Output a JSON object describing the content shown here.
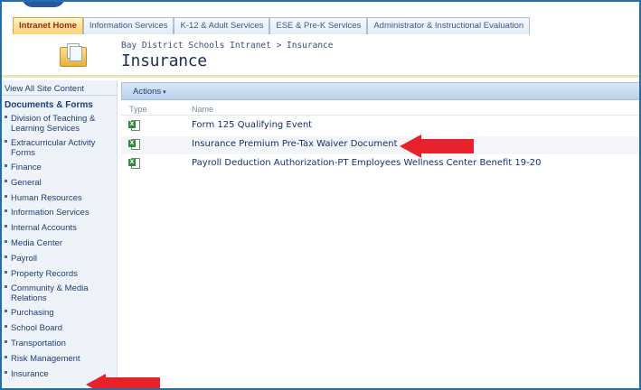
{
  "tabs": [
    {
      "label": "Intranet Home",
      "active": true
    },
    {
      "label": "Information Services",
      "active": false
    },
    {
      "label": "K-12 & Adult Services",
      "active": false
    },
    {
      "label": "ESE & Pre-K Services",
      "active": false
    },
    {
      "label": "Administrator & Instructional Evaluation",
      "active": false
    }
  ],
  "header": {
    "breadcrumb": "Bay District Schools Intranet > Insurance",
    "title": "Insurance",
    "icon": "site-folder-icon"
  },
  "sidebar": {
    "view_all": "View All Site Content",
    "heading": "Documents & Forms",
    "items": [
      "Division of Teaching & Learning Services",
      "Extracurricular Activity Forms",
      "Finance",
      "General",
      "Human Resources",
      "Information Services",
      "Internal Accounts",
      "Media Center",
      "Payroll",
      "Property Records",
      "Community & Media Relations",
      "Purchasing",
      "School Board",
      "Transportation",
      "Risk Management",
      "Insurance"
    ]
  },
  "toolbar": {
    "actions_label": "Actions",
    "actions_caret": "▾"
  },
  "list": {
    "columns": {
      "type": "Type",
      "name": "Name"
    },
    "rows": [
      {
        "icon": "excel-file-icon",
        "name": "Form 125 Qualifying Event"
      },
      {
        "icon": "excel-file-icon",
        "name": "Insurance Premium Pre-Tax Waiver Document"
      },
      {
        "icon": "excel-file-icon",
        "name": "Payroll Deduction Authorization-PT Employees Wellness Center Benefit 19-20"
      }
    ]
  },
  "annotations": {
    "arrow_color": "#e8222a"
  }
}
